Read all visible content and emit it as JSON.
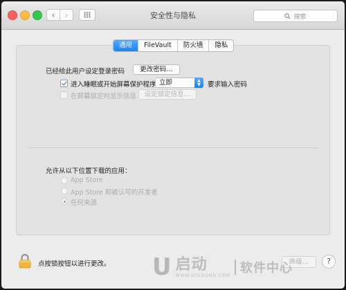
{
  "window": {
    "title": "安全性与隐私",
    "search_placeholder": "搜索"
  },
  "toolbar": {
    "back_glyph": "‹",
    "forward_glyph": "›"
  },
  "tabs": [
    {
      "label": "通用",
      "active": true
    },
    {
      "label": "FileVault",
      "active": false
    },
    {
      "label": "防火墙",
      "active": false
    },
    {
      "label": "隐私",
      "active": false
    }
  ],
  "general": {
    "password_label": "已经给此用户设定登录密码",
    "change_password_button": "更改密码…",
    "require_password_label": "进入睡眠或开始屏幕保护程序",
    "require_password_checked": true,
    "require_password_delay": "立即",
    "require_password_suffix": "要求输入密码",
    "show_message_label": "在屏幕锁定时显示信息",
    "show_message_checked": false,
    "set_lock_message_button": "设定锁定信息…"
  },
  "downloads": {
    "heading": "允许从以下位置下载的应用：",
    "options": [
      {
        "label": "App Store",
        "selected": false
      },
      {
        "label": "App Store 和被认可的开发者",
        "selected": false
      },
      {
        "label": "任何来源",
        "selected": true
      }
    ]
  },
  "footer": {
    "lock_text": "点按锁按钮以进行更改。",
    "advanced_button": "高级…",
    "help_glyph": "?"
  },
  "watermark": {
    "brand_letter": "U",
    "brand_text": "启动",
    "url": "WWW.UQIDONG.COM",
    "tagline": "软件中心"
  },
  "colors": {
    "accent": "#1b84f3",
    "window_bg": "#ececec",
    "lock_yellow": "#f3b43a"
  }
}
